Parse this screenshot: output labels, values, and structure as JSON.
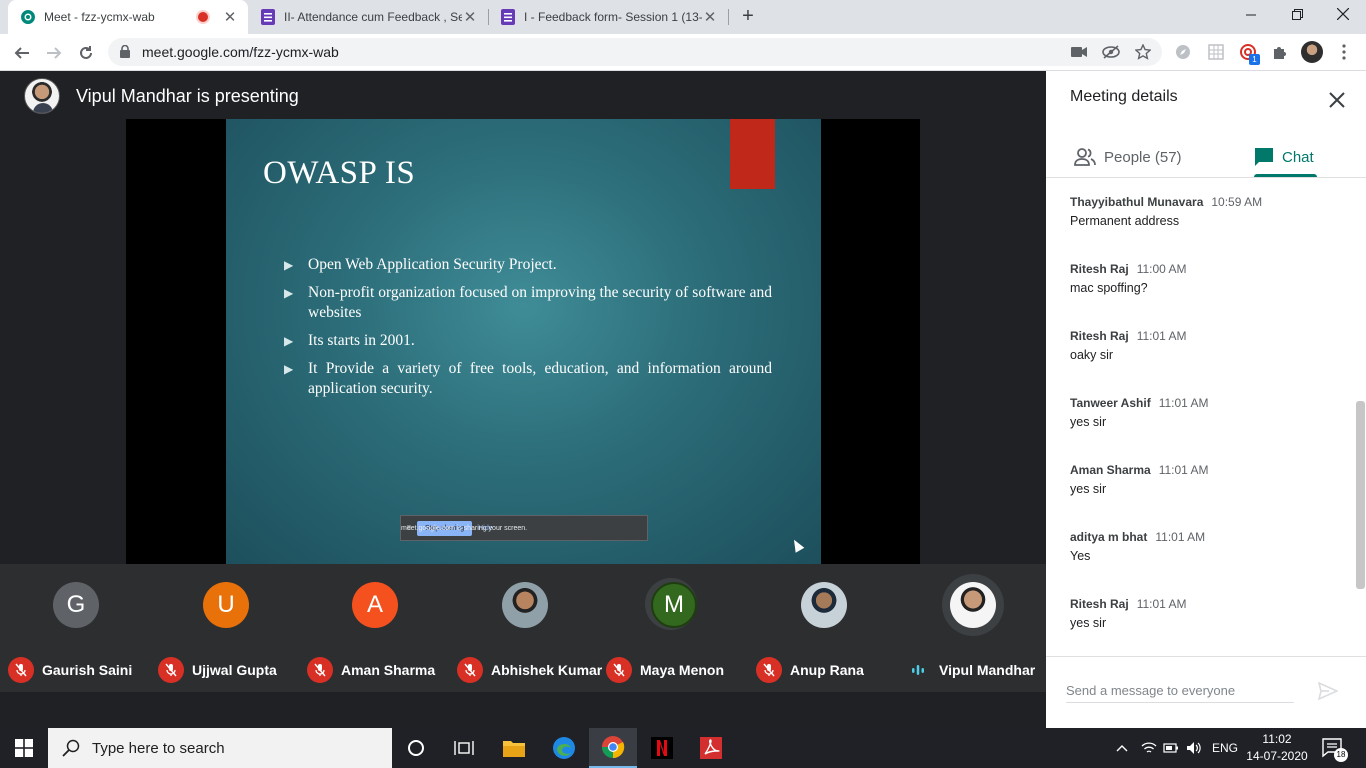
{
  "browser": {
    "tabs": [
      {
        "title": "Meet - fzz-ycmx-wab",
        "favicon": "meet-icon",
        "recording": true
      },
      {
        "title": "II- Attendance cum Feedback , Se",
        "favicon": "forms-icon"
      },
      {
        "title": "I - Feedback form- Session 1 (13-",
        "favicon": "forms-icon"
      }
    ],
    "url": "meet.google.com/fzz-ycmx-wab",
    "extension_badge": "1"
  },
  "stage": {
    "presenter_text": "Vipul Mandhar is presenting"
  },
  "slide": {
    "title": "OWASP IS",
    "bullets": [
      "Open Web Application Security Project.",
      "Non-profit organization focused on improving the security of software and websites",
      " Its starts in 2001.",
      "It Provide a variety of free tools, education, and information around application security."
    ],
    "share_bar": {
      "pause": "II",
      "message": "meet.google.com is sharing your screen.",
      "stop_label": "Stop sharing",
      "hide_label": "Hide"
    },
    "accent_color": "#c0281a"
  },
  "participants": [
    {
      "name": "Gaurish Saini",
      "initial": "G",
      "color": "#5f6368",
      "muted": true
    },
    {
      "name": "Ujjwal Gupta",
      "initial": "U",
      "color": "#e8710a",
      "muted": true
    },
    {
      "name": "Aman Sharma",
      "initial": "A",
      "color": "#f4511e",
      "muted": true
    },
    {
      "name": "Abhishek Kumar",
      "initial": "",
      "photo": true,
      "muted": true
    },
    {
      "name": "Maya Menon",
      "initial": "M",
      "color": "#33691e",
      "muted": true
    },
    {
      "name": "Anup Rana",
      "initial": "",
      "photo": true,
      "muted": true
    },
    {
      "name": "Vipul Mandhar",
      "initial": "",
      "photo": true,
      "muted": false,
      "speaking": true
    }
  ],
  "panel": {
    "title": "Meeting details",
    "people_tab": "People (57)",
    "chat_tab": "Chat",
    "accent": "#00796b",
    "messages": [
      {
        "sender": "Thayyibathul Munavara",
        "time": "10:59 AM",
        "text": "Permanent address"
      },
      {
        "sender": "Ritesh Raj",
        "time": "11:00 AM",
        "text": "mac spoffing?"
      },
      {
        "sender": "Ritesh Raj",
        "time": "11:01 AM",
        "text": "oaky sir"
      },
      {
        "sender": "Tanweer Ashif",
        "time": "11:01 AM",
        "text": "yes sir"
      },
      {
        "sender": "Aman Sharma",
        "time": "11:01 AM",
        "text": "yes sir"
      },
      {
        "sender": "aditya m bhat",
        "time": "11:01 AM",
        "text": "Yes"
      },
      {
        "sender": "Ritesh Raj",
        "time": "11:01 AM",
        "text": "yes sir"
      }
    ],
    "compose_placeholder": "Send a message to everyone"
  },
  "taskbar": {
    "search_placeholder": "Type here to search",
    "language": "ENG",
    "time": "11:02",
    "date": "14-07-2020",
    "notification_count": "18"
  }
}
